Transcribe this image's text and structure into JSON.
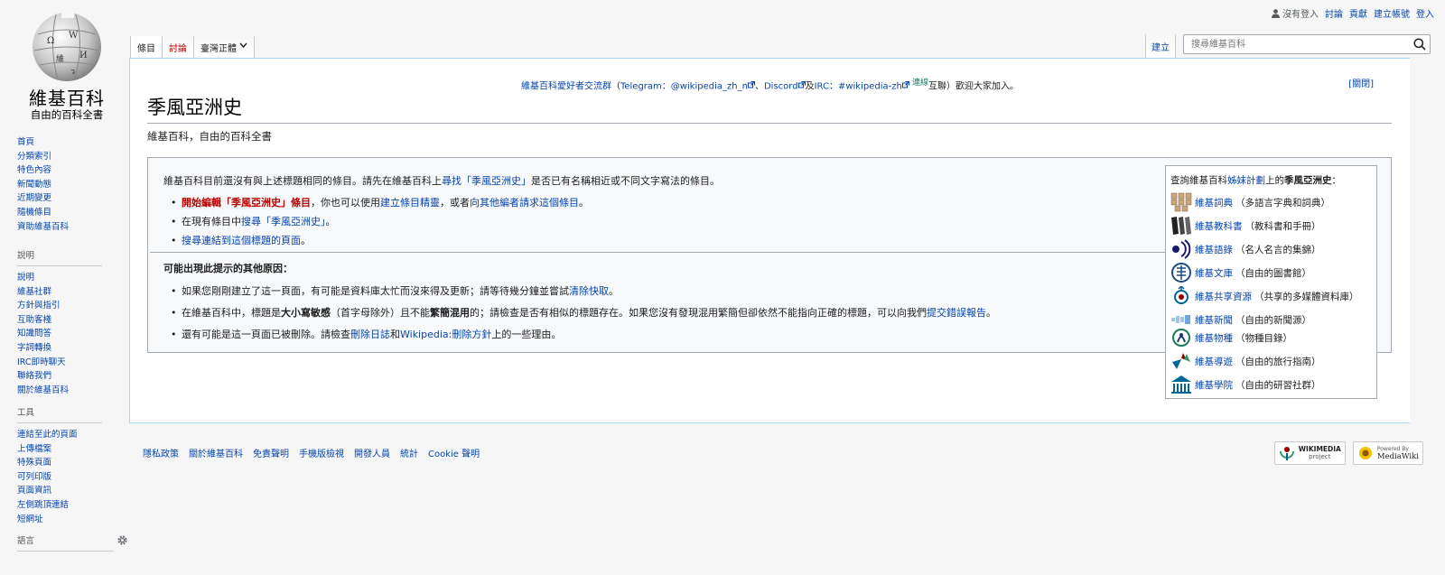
{
  "logo": {
    "wordmark": "維基百科",
    "tagline": "自由的百科全書"
  },
  "personal": {
    "not_logged_in": "沒有登入",
    "talk": "討論",
    "contributions": "貢獻",
    "create_account": "建立帳號",
    "login": "登入"
  },
  "tabs": {
    "article": "條目",
    "talk": "討論",
    "variant": "臺灣正體",
    "create": "建立"
  },
  "search": {
    "placeholder": "搜尋維基百科"
  },
  "sitenotice": {
    "group": "維基百科愛好者交流群",
    "open_paren": "（",
    "telegram": "Telegram：@wikipedia_zh_n",
    "sep1": "、",
    "discord": "Discord",
    "and": "及",
    "irc": "IRC：#wikipedia-zh",
    "linked_sup": "連線",
    "bridged": "互聯",
    "close_text": "）歡迎大家加入。",
    "dismiss": "[關閉]"
  },
  "page": {
    "title": "季風亞洲史",
    "tagline": "維基百科，自由的百科全書"
  },
  "noarticle": {
    "lead_prefix": "維基百科目前還沒有與上述標題相同的條目。請先在維基百科上",
    "lead_link": "尋找「季風亞洲史」",
    "lead_suffix": "是否已有名稱相近或不同文字寫法的條目。",
    "b1_link": "開始編輯「季風亞洲史」條目",
    "b1_mid": "，你也可以使用",
    "b1_link2": "建立條目精靈",
    "b1_mid2": "，或者",
    "b1_link3": "向其他編者請求這個條目",
    "b1_end": "。",
    "b2_prefix": "在現有條目中",
    "b2_link": "搜尋「季風亞洲史」",
    "b2_end": "。",
    "b3_link": "搜尋連結到這個標題的頁面",
    "b3_end": "。",
    "reasons_head": "可能出現此提示的其他原因：",
    "r1_prefix": "如果您剛剛建立了這一頁面，有可能是資料庫太忙而沒來得及更新；請等待幾分鐘並嘗試",
    "r1_link": "清除快取",
    "r1_end": "。",
    "r2_a": "在維基百科中，標題是",
    "r2_bold1": "大小寫敏感",
    "r2_b": "（首字母除外）且不能",
    "r2_bold2": "繁簡混用",
    "r2_c": "的；請檢查是否有相似的標題存在。如果您沒有發現混用繁簡但卻依然不能指向正確的標題，可以向我們",
    "r2_link": "提交錯誤報告",
    "r2_end": "。",
    "r3_prefix": "還有可能是這一頁面已被刪除。請檢查",
    "r3_link1": "刪除日誌",
    "r3_and": "和",
    "r3_link2": "Wikipedia:刪除方針",
    "r3_end": "上的一些理由。"
  },
  "sister": {
    "head_prefix": "查詢維基百科",
    "head_link": "姊妹計劃",
    "head_suffix": "上的",
    "head_bold": "季風亞洲史",
    "head_end": "：",
    "items": [
      {
        "name": "維基詞典",
        "desc": "（多語言字典和詞典）"
      },
      {
        "name": "維基教科書",
        "desc": "（教科書和手冊）"
      },
      {
        "name": "維基語錄",
        "desc": "（名人名言的集錦）"
      },
      {
        "name": "維基文庫",
        "desc": "（自由的圖書館）"
      },
      {
        "name": "維基共享資源",
        "desc": "（共享的多媒體資料庫）"
      },
      {
        "name": "維基新聞",
        "desc": "（自由的新聞源）"
      },
      {
        "name": "維基物種",
        "desc": "（物種目錄）"
      },
      {
        "name": "維基導遊",
        "desc": "（自由的旅行指南）"
      },
      {
        "name": "維基學院",
        "desc": "（自由的研習社群）"
      }
    ]
  },
  "nav": {
    "main": [
      "首頁",
      "分類索引",
      "特色內容",
      "新聞動態",
      "近期變更",
      "隨機條目",
      "資助維基百科"
    ],
    "help_head": "說明",
    "help": [
      "說明",
      "維基社群",
      "方針與指引",
      "互助客棧",
      "知識問答",
      "字詞轉換",
      "IRC即時聊天",
      "聯絡我們",
      "關於維基百科"
    ],
    "tools_head": "工具",
    "tools": [
      "連結至此的頁面",
      "上傳檔案",
      "特殊頁面",
      "可列印版",
      "頁面資訊",
      "左側跳頂連結",
      "短網址"
    ],
    "lang_head": "語言"
  },
  "footer": {
    "links": [
      "隱私政策",
      "關於維基百科",
      "免責聲明",
      "手機版檢視",
      "開發人員",
      "統計",
      "Cookie 聲明"
    ],
    "wikimedia": {
      "top": "WIKIMEDIA",
      "bottom": "project"
    },
    "mediawiki": {
      "top": "Powered By",
      "bottom": "MediaWiki"
    }
  }
}
